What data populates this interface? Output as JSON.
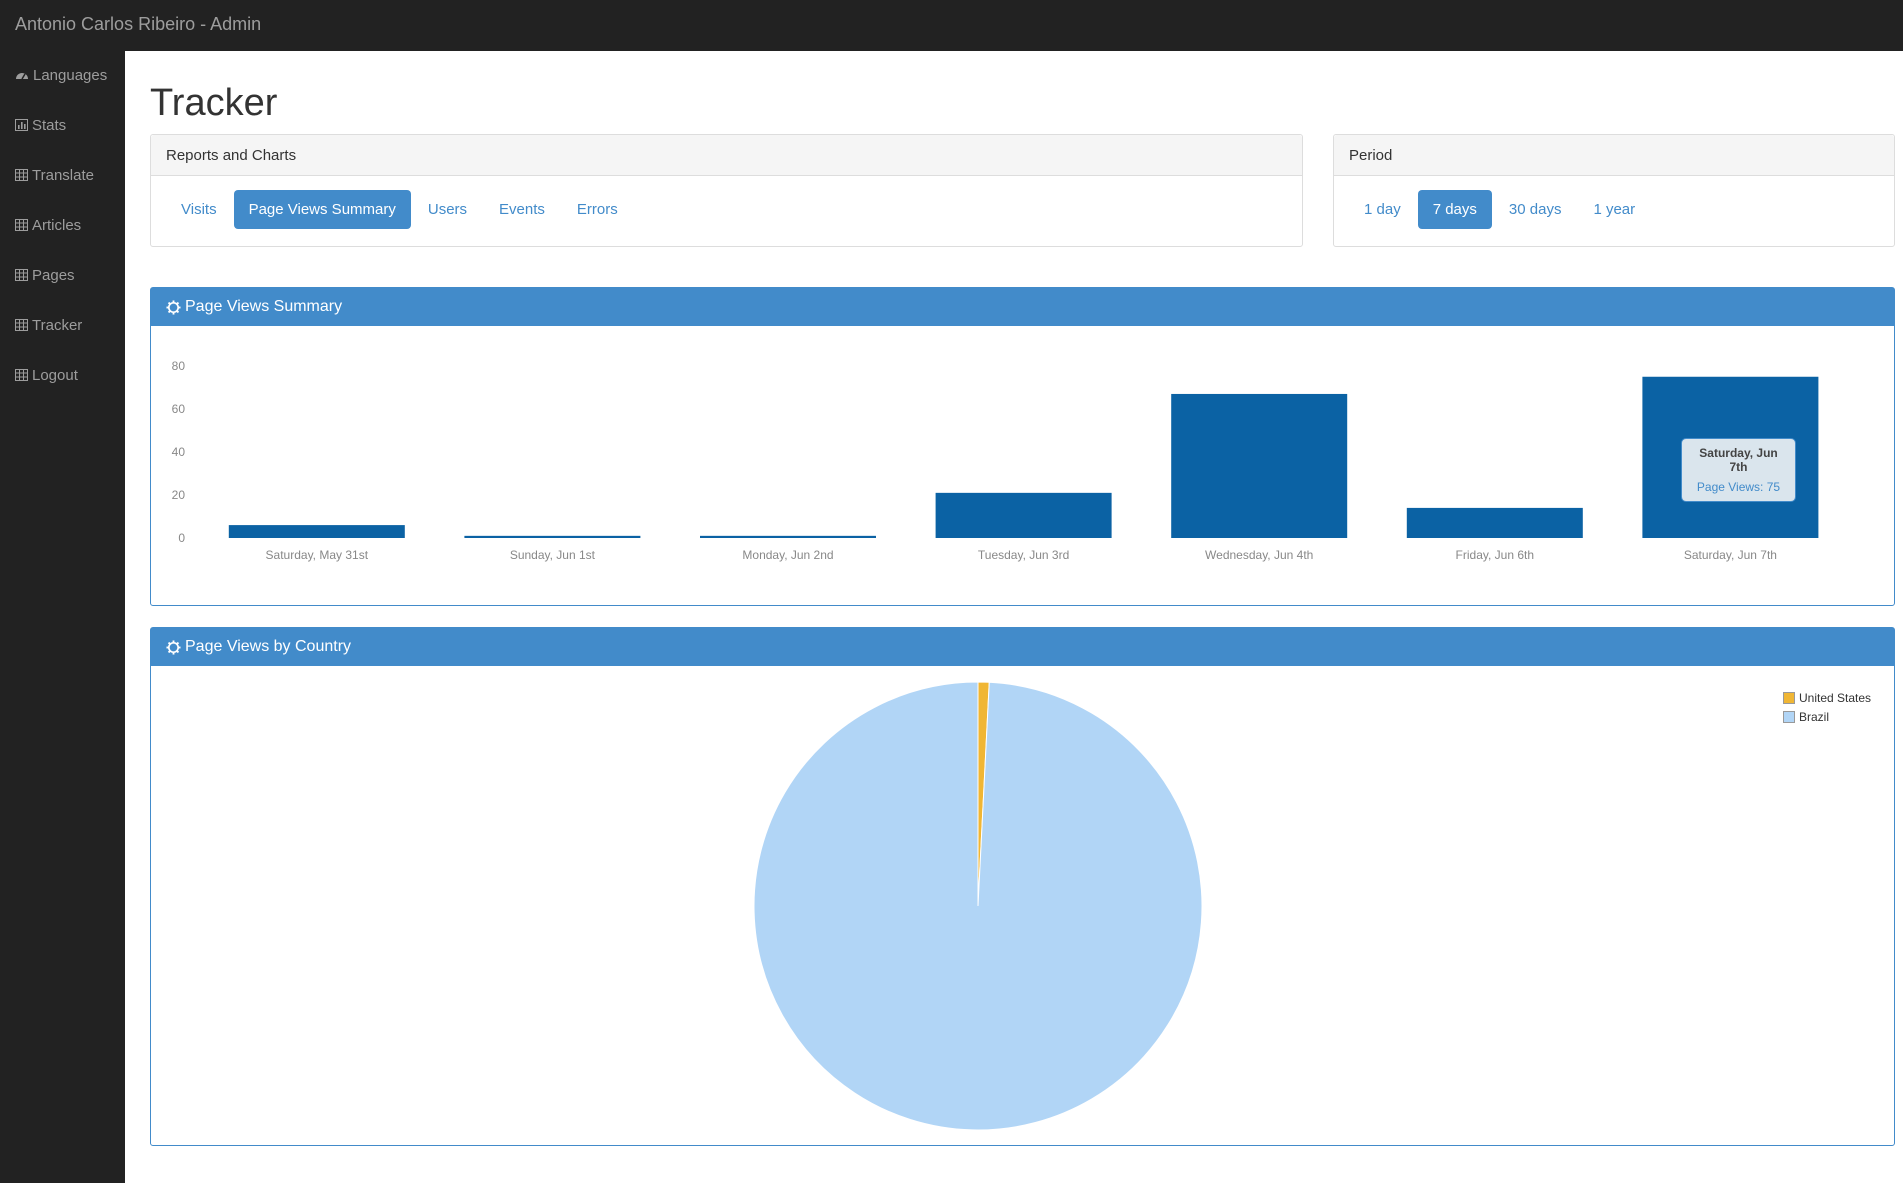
{
  "app": {
    "brand": "Antonio Carlos Ribeiro - Admin"
  },
  "sidebar": {
    "items": [
      {
        "label": "Languages",
        "icon": "dashboard-icon"
      },
      {
        "label": "Stats",
        "icon": "bar-chart-icon"
      },
      {
        "label": "Translate",
        "icon": "table-icon"
      },
      {
        "label": "Articles",
        "icon": "table-icon"
      },
      {
        "label": "Pages",
        "icon": "table-icon"
      },
      {
        "label": "Tracker",
        "icon": "table-icon"
      },
      {
        "label": "Logout",
        "icon": "table-icon"
      }
    ]
  },
  "main": {
    "title": "Tracker",
    "reports": {
      "heading": "Reports and Charts",
      "tabs": [
        "Visits",
        "Page Views Summary",
        "Users",
        "Events",
        "Errors"
      ],
      "active": "Page Views Summary"
    },
    "period": {
      "heading": "Period",
      "options": [
        "1 day",
        "7 days",
        "30 days",
        "1 year"
      ],
      "active": "7 days"
    },
    "summary_panel": {
      "title": "Page Views Summary",
      "icon": "cog-icon"
    },
    "country_panel": {
      "title": "Page Views by Country",
      "icon": "cog-icon"
    },
    "tooltip": {
      "title": "Saturday, Jun 7th",
      "body": "Page Views: 75"
    }
  },
  "colors": {
    "primary": "#428bca",
    "bar": "#0b62a4",
    "topbar": "#222222",
    "pie_us": "#f0b634",
    "pie_brazil": "#b1d5f6"
  },
  "chart_data": [
    {
      "type": "bar",
      "categories": [
        "Saturday, May 31st",
        "Sunday, Jun 1st",
        "Monday, Jun 2nd",
        "Tuesday, Jun 3rd",
        "Wednesday, Jun 4th",
        "Friday, Jun 6th",
        "Saturday, Jun 7th"
      ],
      "series": [
        {
          "values": [
            6,
            1,
            1,
            21,
            67,
            14,
            75
          ]
        }
      ],
      "yticks": [
        "0",
        "20",
        "40",
        "60",
        "80"
      ],
      "ylim": [
        0,
        80
      ],
      "grid": false
    },
    {
      "type": "pie",
      "labels": [
        "United States",
        "Brazil"
      ],
      "values": [
        0.8,
        99.2
      ],
      "colors": [
        "#f0b634",
        "#b1d5f6"
      ],
      "legend": "top-right"
    }
  ]
}
